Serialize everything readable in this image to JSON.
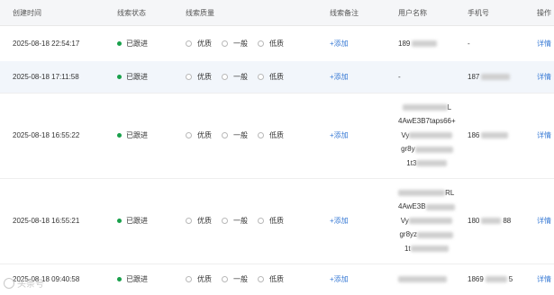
{
  "headers": {
    "time": "创建时间",
    "status": "线索状态",
    "quality": "线索质量",
    "note": "线索备注",
    "user": "用户名称",
    "phone": "手机号",
    "action": "操作"
  },
  "quality_options": [
    "优质",
    "一般",
    "低质"
  ],
  "rows": [
    {
      "time": "2025-08-18 22:54:17",
      "status": "已跟进",
      "note": "+添加",
      "user": [
        "189"
      ],
      "phone": "-",
      "action": "详情"
    },
    {
      "time": "2025-08-18 17:11:58",
      "status": "已跟进",
      "note": "+添加",
      "user": [
        "-"
      ],
      "phone": "187",
      "action": "详情"
    },
    {
      "time": "2025-08-18 16:55:22",
      "status": "已跟进",
      "note": "+添加",
      "user": [
        "L",
        "4AwE3B7taps66+",
        "Vy",
        "gr8y",
        "1t3"
      ],
      "phone": "186",
      "action": "详情"
    },
    {
      "time": "2025-08-18 16:55:21",
      "status": "已跟进",
      "note": "+添加",
      "user": [
        "RL",
        "4AwE3B",
        "Vy",
        "gr8yz",
        "1t"
      ],
      "phone": "180",
      "phone_suffix": "88",
      "action": "详情"
    },
    {
      "time": "2025-08-18 09:40:58",
      "status": "已跟进",
      "note": "+添加",
      "user": [
        ""
      ],
      "phone": "1869",
      "phone_suffix": "5",
      "action": "详情"
    }
  ],
  "watermark": "头条号"
}
